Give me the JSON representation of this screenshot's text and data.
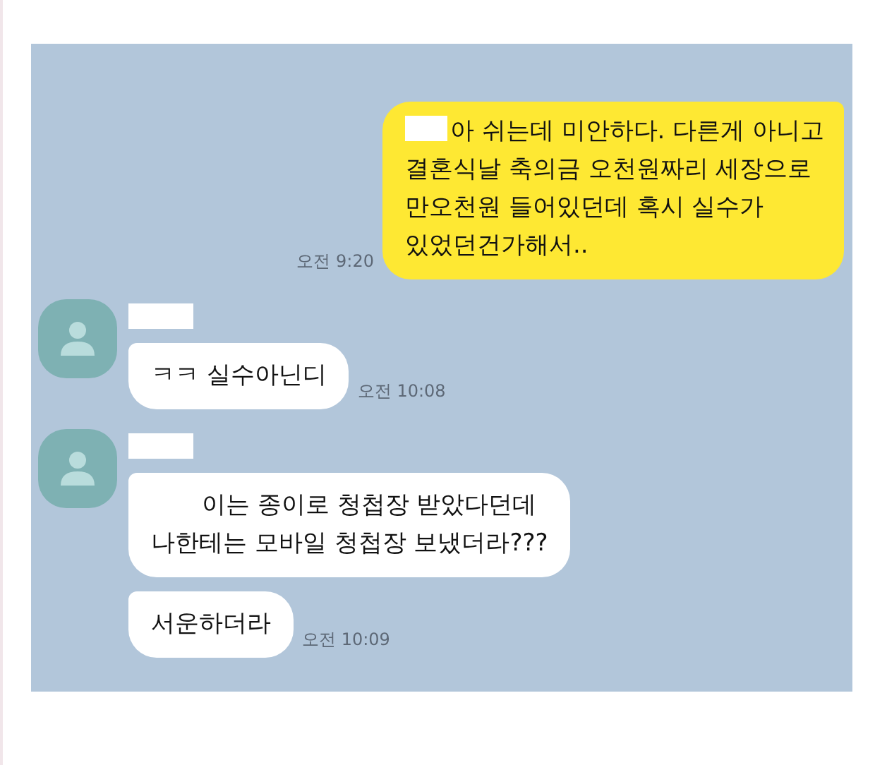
{
  "messages": [
    {
      "kind": "sent",
      "time": "오전 9:20",
      "bubbles": [
        {
          "redacted": true,
          "indented": false,
          "lines": [
            "아 쉬는데 미안하다. 다른게 아니고",
            "결혼식날 축의금 오천원짜리 세장으로",
            "만오천원 들어있던데 혹시 실수가",
            "있었던건가해서.."
          ]
        }
      ]
    },
    {
      "kind": "received",
      "time": "오전 10:08",
      "bubbles": [
        {
          "redacted": false,
          "indented": false,
          "lines": [
            "ㅋㅋ 실수아닌디"
          ]
        }
      ]
    },
    {
      "kind": "received",
      "time": "오전 10:09",
      "bubbles": [
        {
          "redacted": false,
          "indented": true,
          "lines": [
            "이는 종이로 청첩장 받았다던데",
            "나한테는 모바일 청첩장 보냈더라???"
          ]
        },
        {
          "redacted": false,
          "indented": false,
          "lines": [
            "서운하더라"
          ]
        }
      ]
    }
  ]
}
